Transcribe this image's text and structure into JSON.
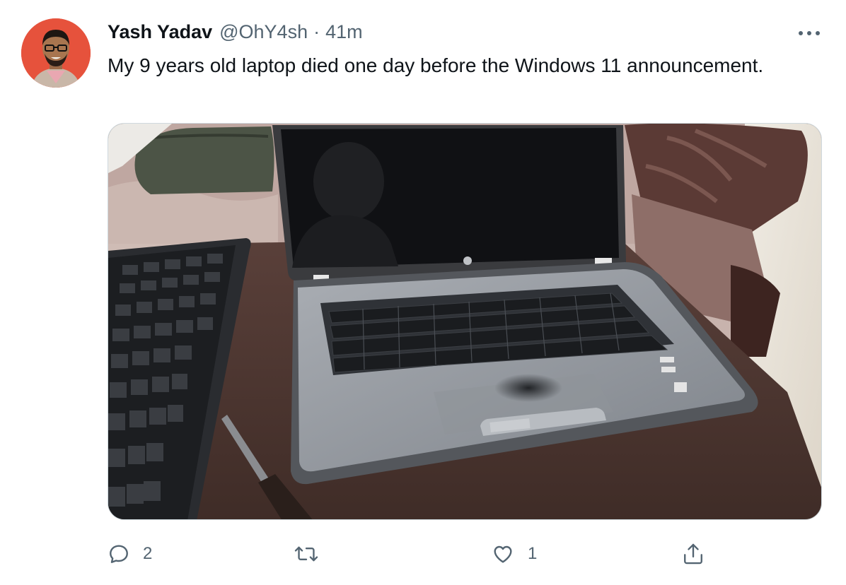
{
  "tweet": {
    "author_name": "Yash Yadav",
    "handle": "@OhY4sh",
    "separator": "·",
    "time": "41m",
    "text": "My 9 years old laptop died one day before the Windows 11 announcement."
  },
  "actions": {
    "reply_count": "2",
    "retweet_count": "",
    "like_count": "1"
  },
  "icons": {
    "more": "more-horizontal-icon",
    "reply": "reply-icon",
    "retweet": "retweet-icon",
    "like": "heart-icon",
    "share": "share-icon"
  },
  "colors": {
    "text": "#0f1419",
    "secondary": "#536471",
    "avatar_bg": "#e9533f"
  }
}
